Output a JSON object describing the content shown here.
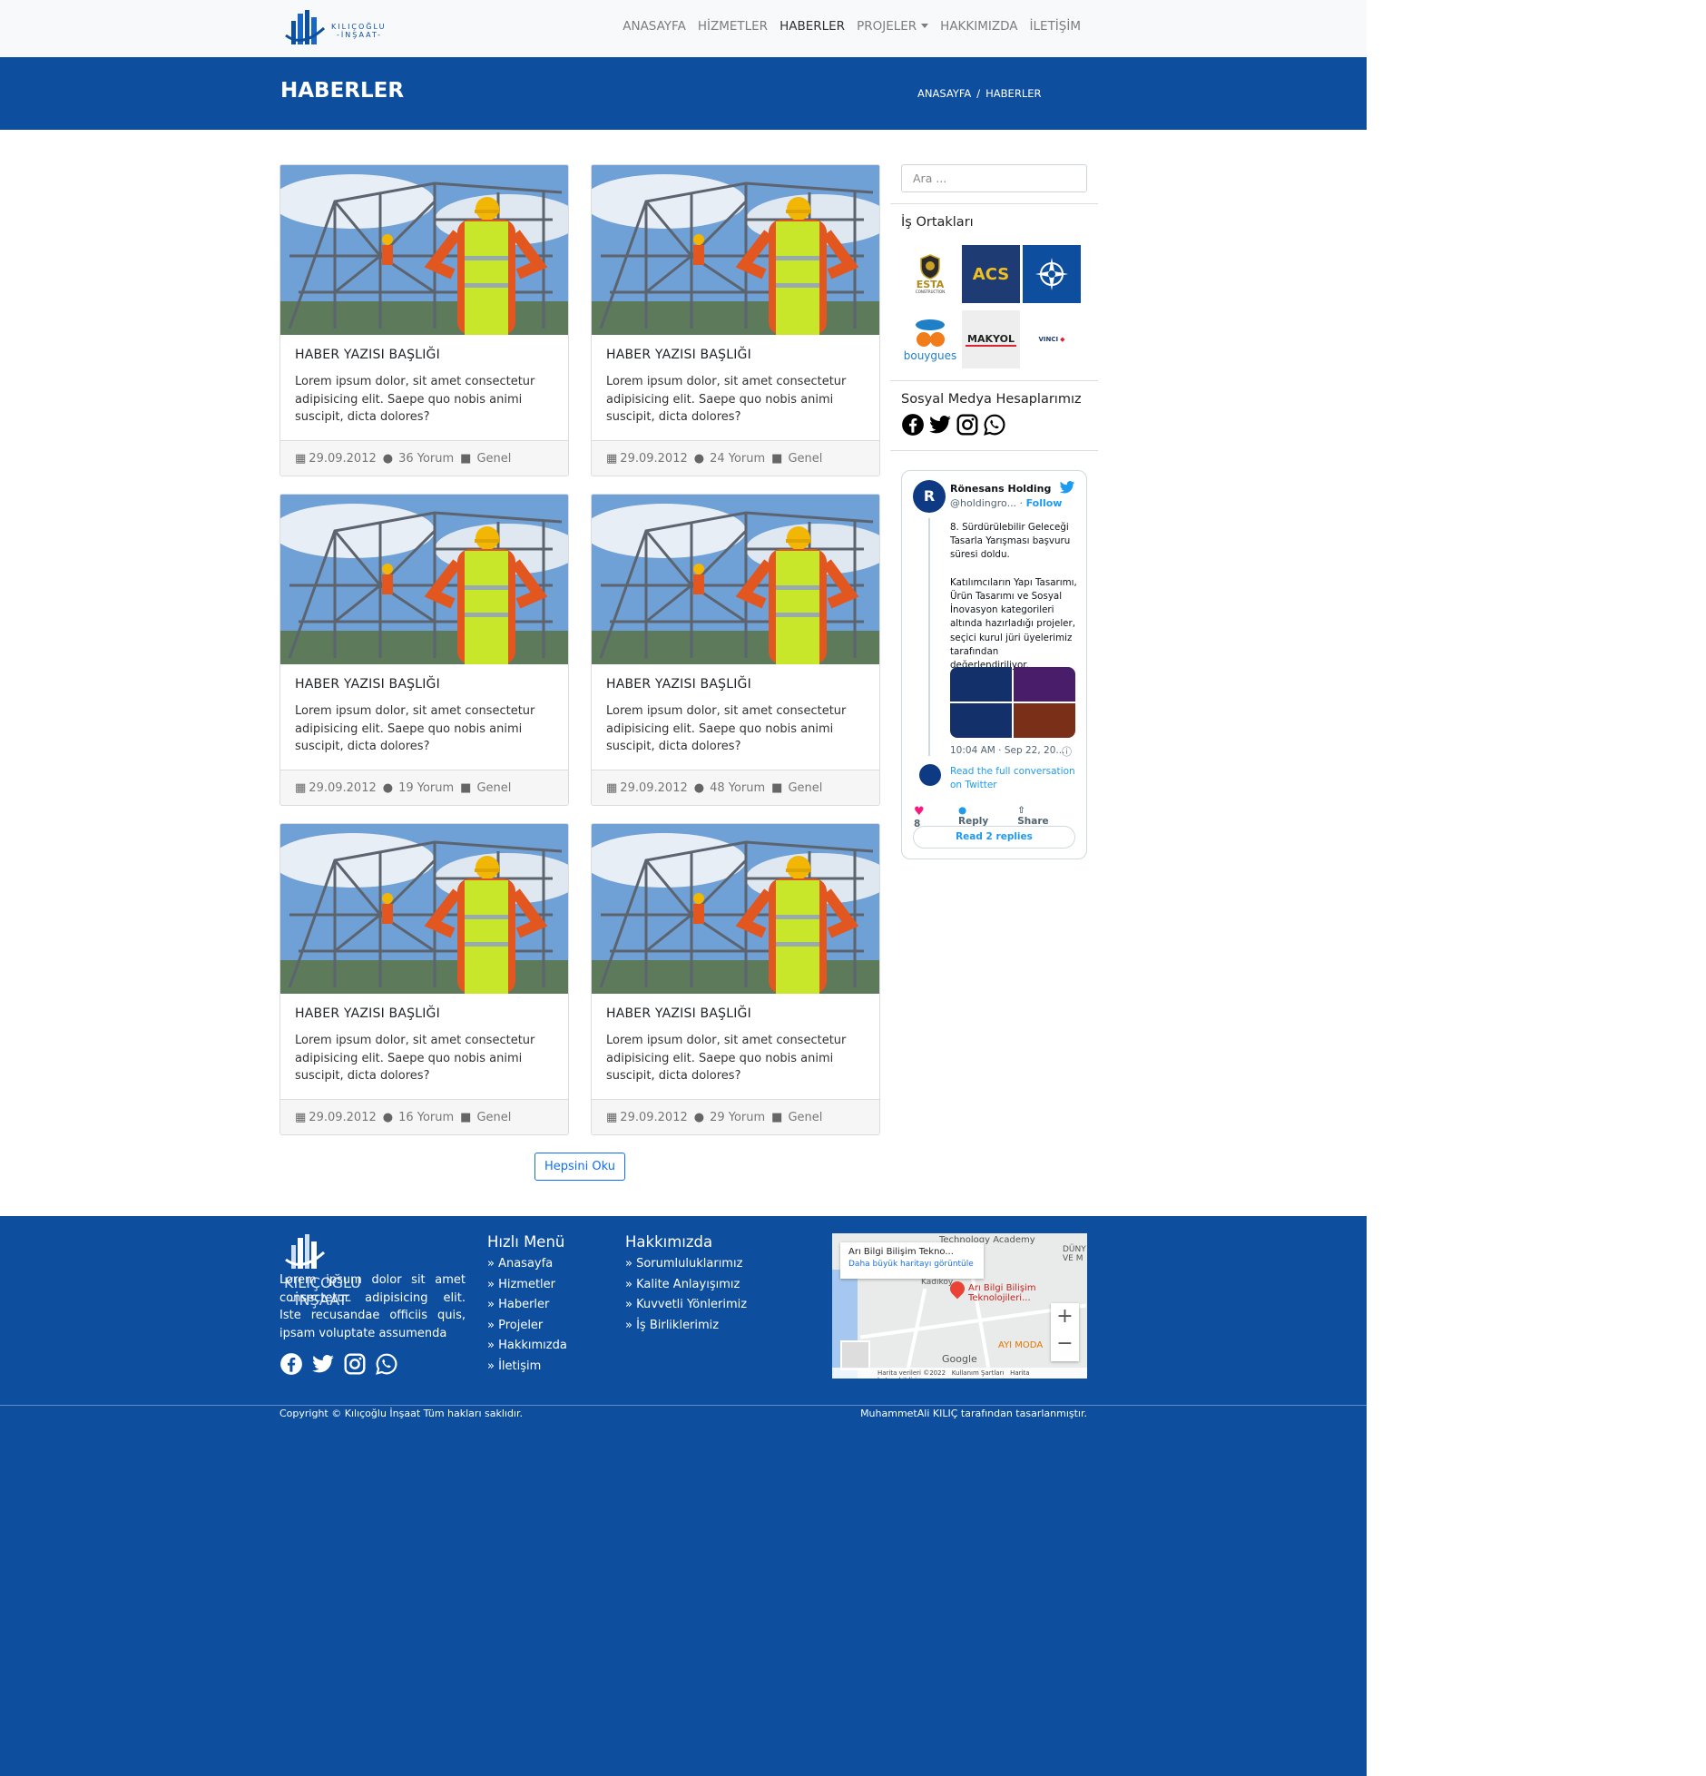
{
  "nav": {
    "logo_text_1": "KILIÇOĞLU",
    "logo_text_2": "-İNŞAAT-",
    "items": [
      {
        "label": "ANASAYFA"
      },
      {
        "label": "HİZMETLER"
      },
      {
        "label": "HABERLER"
      },
      {
        "label": "PROJELER"
      },
      {
        "label": "HAKKIMIZDA"
      },
      {
        "label": "İLETİŞİM"
      }
    ]
  },
  "hero": {
    "title": "HABERLER",
    "breadcrumb": [
      "ANASAYFA",
      "/",
      "HABERLER"
    ]
  },
  "posts": [
    {
      "title": "HABER YAZISI BAŞLIĞI",
      "excerpt": "Lorem ipsum dolor, sit amet consectetur adipisicing elit. Saepe quo nobis animi suscipit, dicta dolores?",
      "date": "29.09.2012",
      "comments": "36 Yorum",
      "category": "Genel"
    },
    {
      "title": "HABER YAZISI BAŞLIĞI",
      "excerpt": "Lorem ipsum dolor, sit amet consectetur adipisicing elit. Saepe quo nobis animi suscipit, dicta dolores?",
      "date": "29.09.2012",
      "comments": "24 Yorum",
      "category": "Genel"
    },
    {
      "title": "HABER YAZISI BAŞLIĞI",
      "excerpt": "Lorem ipsum dolor, sit amet consectetur adipisicing elit. Saepe quo nobis animi suscipit, dicta dolores?",
      "date": "29.09.2012",
      "comments": "19 Yorum",
      "category": "Genel"
    },
    {
      "title": "HABER YAZISI BAŞLIĞI",
      "excerpt": "Lorem ipsum dolor, sit amet consectetur adipisicing elit. Saepe quo nobis animi suscipit, dicta dolores?",
      "date": "29.09.2012",
      "comments": "48 Yorum",
      "category": "Genel"
    },
    {
      "title": "HABER YAZISI BAŞLIĞI",
      "excerpt": "Lorem ipsum dolor, sit amet consectetur adipisicing elit. Saepe quo nobis animi suscipit, dicta dolores?",
      "date": "29.09.2012",
      "comments": "16 Yorum",
      "category": "Genel"
    },
    {
      "title": "HABER YAZISI BAŞLIĞI",
      "excerpt": "Lorem ipsum dolor, sit amet consectetur adipisicing elit. Saepe quo nobis animi suscipit, dicta dolores?",
      "date": "29.09.2012",
      "comments": "29 Yorum",
      "category": "Genel"
    }
  ],
  "read_all_label": "Hepsini Oku",
  "sidebar": {
    "search_placeholder": "Ara ...",
    "partners_title": "İş Ortakları",
    "partners": [
      "ESTA",
      "ACS",
      "",
      "bouygues",
      "MAKYOL",
      "VINCI"
    ],
    "partner_sub": "CONSTRUCTION",
    "social_title": "Sosyal Medya Hesaplarımız"
  },
  "tweet": {
    "name": "Rönesans Holding",
    "handle": "@holdingro...",
    "follow": "Follow",
    "text": "8. Sürdürülebilir Geleceği Tasarla Yarışması başvuru süresi doldu.\n\nKatılımcıların Yapı Tasarımı, Ürün Tasarımı ve Sosyal İnovasyon kategorileri altında hazırladığı projeler, seçici kurul jüri üyelerimiz tarafından değerlendiriliyor.",
    "time": "10:04 AM · Sep 22, 20...",
    "full_conversation": "Read the full conversation on Twitter",
    "likes": "8",
    "reply": "Reply",
    "share": "Share",
    "read_replies": "Read 2 replies"
  },
  "footer": {
    "about": "Lorem ipsum dolor sit amet consectetur adipisicing elit. Iste recusandae officiis quis, ipsam voluptate assumenda",
    "menu_title": "Hızlı Menü",
    "menu": [
      "» Anasayfa",
      "» Hizmetler",
      "» Haberler",
      "» Projeler",
      "» Hakkımızda",
      "» İletişim"
    ],
    "about_title": "Hakkımızda",
    "about_links": [
      "» Sorumluluklarımız",
      "» Kalite Anlayışımız",
      "» Kuvvetli Yönlerimiz",
      "» İş Birliklerimiz"
    ],
    "copyright": "Copyright © Kılıçoğlu İnşaat Tüm hakları saklıdır.",
    "credit": "MuhammetAli KILIÇ tarafından tasarlanmıştır."
  },
  "map": {
    "place": "Arı Bilgi Bilişim Tekno...",
    "larger_map": "Daha büyük haritayı görüntüle",
    "pin_label": "Arı Bilgi Bilişim Teknolojileri...",
    "label_academy": "Technology Academy",
    "label_kadikoy": "Kadıköy",
    "label_dunya": "DÜNY VE M",
    "label_ayi": "AYI MODA",
    "google": "Google",
    "attr_1": "Harita verileri ©2022",
    "attr_2": "Kullanım Şartları",
    "attr_3": "Harita hatası bildirin"
  },
  "colors": {
    "brand": "#0d4f9e",
    "twitter": "#1d9bf0"
  }
}
